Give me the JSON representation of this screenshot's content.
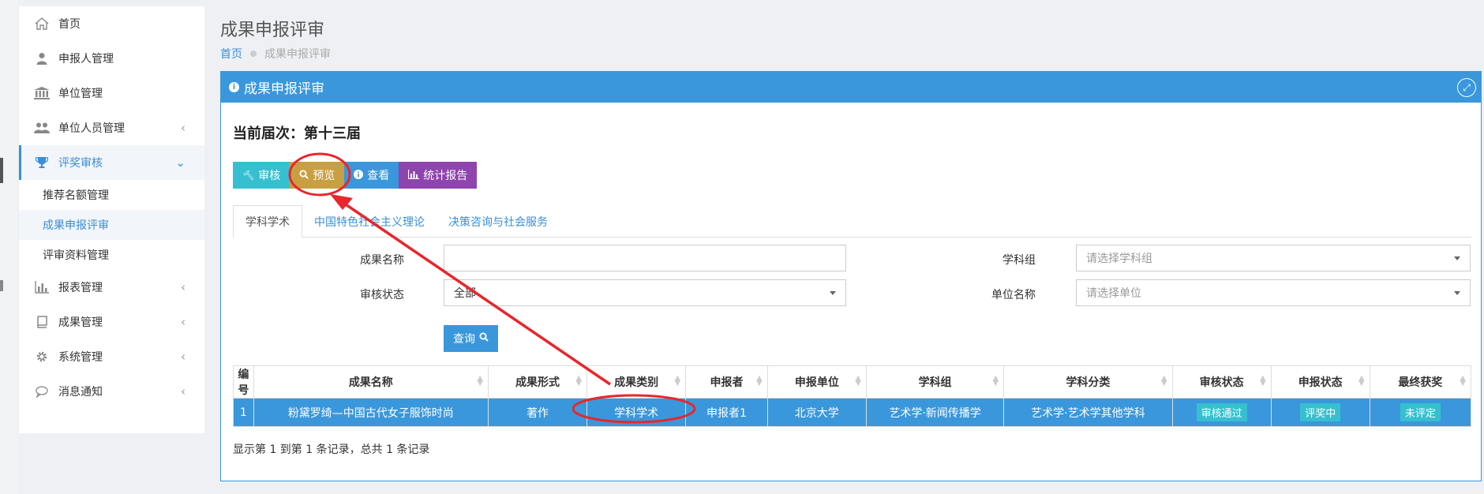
{
  "sidebar": {
    "items": [
      {
        "label": "首页",
        "icon": "home-icon"
      },
      {
        "label": "申报人管理",
        "icon": "user-icon"
      },
      {
        "label": "单位管理",
        "icon": "bank-icon"
      },
      {
        "label": "单位人员管理",
        "icon": "users-icon"
      },
      {
        "label": "评奖审核",
        "icon": "trophy-icon"
      },
      {
        "label": "报表管理",
        "icon": "bar-chart-icon"
      },
      {
        "label": "成果管理",
        "icon": "book-icon"
      },
      {
        "label": "系统管理",
        "icon": "gear-icon"
      },
      {
        "label": "消息通知",
        "icon": "message-icon"
      }
    ],
    "sub_items": [
      {
        "label": "推荐名额管理"
      },
      {
        "label": "成果申报评审"
      },
      {
        "label": "评审资料管理"
      }
    ]
  },
  "header": {
    "title": "成果申报评审",
    "breadcrumb": {
      "home": "首页",
      "current": "成果申报评审"
    }
  },
  "panel": {
    "title": "成果申报评审",
    "session_label": "当前届次：第十三届",
    "buttons": {
      "review": "审核",
      "preview": "预览",
      "view": "查看",
      "report": "统计报告"
    },
    "tabs": [
      "学科学术",
      "中国特色社会主义理论",
      "决策咨询与社会服务"
    ],
    "form": {
      "name_label": "成果名称",
      "name_value": "",
      "group_label": "学科组",
      "group_placeholder": "请选择学科组",
      "status_label": "审核状态",
      "status_value": "全部",
      "unit_label": "单位名称",
      "unit_placeholder": "请选择单位",
      "query_button": "查询"
    },
    "table": {
      "columns": [
        "编号",
        "成果名称",
        "成果形式",
        "成果类别",
        "申报者",
        "申报单位",
        "学科组",
        "学科分类",
        "审核状态",
        "申报状态",
        "最终获奖"
      ],
      "rows": [
        [
          "1",
          "粉黛罗绮—中国古代女子服饰时尚",
          "著作",
          "学科学术",
          "申报者1",
          "北京大学",
          "艺术学·新闻传播学",
          "艺术学·艺术学其他学科",
          "审核通过",
          "评奖中",
          "未评定"
        ]
      ]
    },
    "footer": "显示第 1 到第 1 条记录，总共 1 条记录"
  },
  "colors": {
    "primary": "#3a97dc",
    "teal": "#36c0cf",
    "gold": "#c8a043",
    "purple": "#8e44ad",
    "annotation": "#e8262b"
  }
}
